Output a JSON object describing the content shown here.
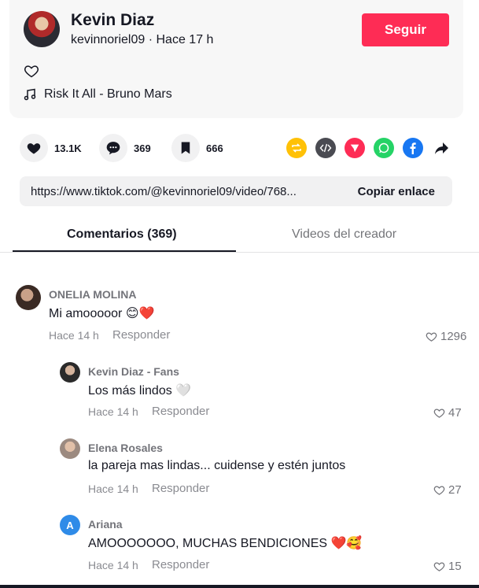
{
  "post": {
    "author_name": "Kevin Diaz",
    "author_meta": "kevinnoriel09 · Hace 17 h",
    "follow_label": "Seguir",
    "music": "Risk It All - Bruno Mars"
  },
  "actions": {
    "likes": "13.1K",
    "comments": "369",
    "saves": "666"
  },
  "share_icons": [
    "repost-icon",
    "embed-icon",
    "send-icon",
    "whatsapp-icon",
    "facebook-icon",
    "share-arrow-icon"
  ],
  "colors": {
    "accent": "#fe2c55",
    "repost": "#ffc107",
    "embed": "#4a4b52",
    "send": "#fe2c55",
    "whatsapp": "#25d366",
    "facebook": "#1877f2"
  },
  "link": {
    "url": "https://www.tiktok.com/@kevinnoriel09/video/768...",
    "copy_label": "Copiar enlace"
  },
  "tabs": [
    {
      "label": "Comentarios (369)",
      "active": true
    },
    {
      "label": "Videos del creador",
      "active": false
    }
  ],
  "comments": [
    {
      "user": "ONELIA MOLINA",
      "text": "Mi amooooor 😊❤️",
      "time": "Hace 14 h",
      "reply": "Responder",
      "likes": "1296"
    },
    {
      "user": "Kevin Diaz - Fans",
      "text": "Los más lindos 🤍",
      "time": "Hace 14 h",
      "reply": "Responder",
      "likes": "47"
    },
    {
      "user": "Elena Rosales",
      "text": "la pareja mas lindas... cuidense y estén juntos",
      "time": "Hace 14 h",
      "reply": "Responder",
      "likes": "27"
    },
    {
      "user": "Ariana",
      "avatar_letter": "A",
      "text": "AMOOOOOOO, MUCHAS BENDICIONES ❤️🥰",
      "time": "Hace 14 h",
      "reply": "Responder",
      "likes": "15"
    }
  ]
}
